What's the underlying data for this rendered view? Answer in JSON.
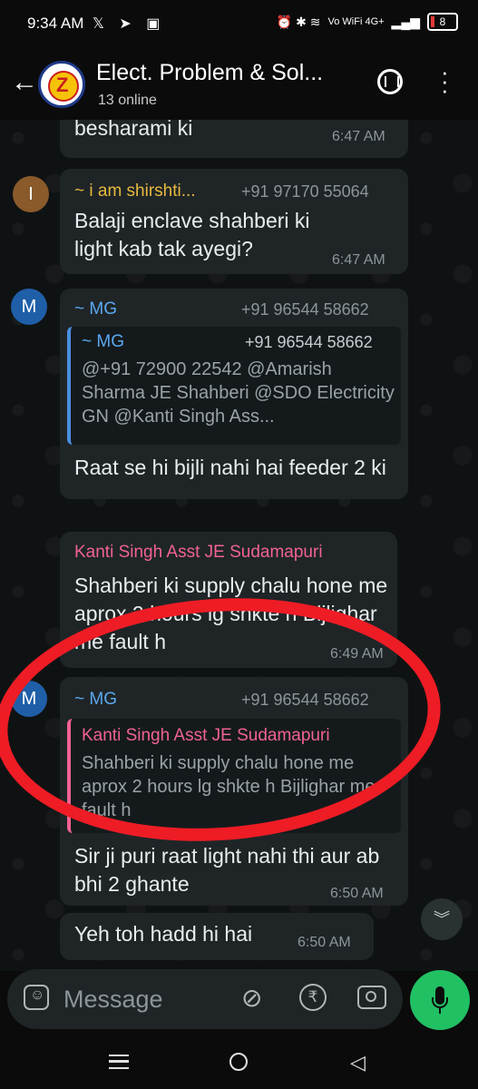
{
  "status_bar": {
    "time": "9:34 AM",
    "left_icons": "𝕏 ➤ ▣",
    "right_icons": "⏰ ✱ ≋",
    "network": "Vo WiFi 4G+",
    "battery": "8"
  },
  "header": {
    "title": "Elect. Problem & Sol...",
    "subtitle": "13 online"
  },
  "messages": [
    {
      "text": "besharami ki",
      "time": "6:47 AM"
    },
    {
      "avatar": "I",
      "sender": "~ i am shirshti...",
      "phone": "+91 97170 55064",
      "text": "Balaji enclave shahberi ki light kab tak ayegi?",
      "time": "6:47 AM"
    },
    {
      "avatar": "M",
      "sender": "~ MG",
      "phone": "+91 96544 58662",
      "quote": {
        "sender": "~ MG",
        "phone": "+91 96544 58662",
        "text": "@+91 72900 22542 @Amarish Sharma JE Shahberi @SDO Electricity GN @Kanti Singh Ass..."
      },
      "text": "Raat se hi bijli nahi hai feeder 2 ki",
      "time": "6:47 AM"
    },
    {
      "sender": "Kanti Singh Asst JE Sudamapuri",
      "text": "Shahberi ki supply chalu hone me aprox 2 hours lg shkte h Bijlighar me fault h",
      "time": "6:49 AM"
    },
    {
      "avatar": "M",
      "sender": "~ MG",
      "phone": "+91 96544 58662",
      "quote": {
        "sender": "Kanti Singh Asst JE Sudamapuri",
        "text": "Shahberi ki supply chalu hone me aprox 2 hours lg shkte h Bijlighar me fault h"
      },
      "text": "Sir ji puri raat light nahi thi aur ab bhi 2 ghante",
      "time": "6:50 AM"
    },
    {
      "text": "Yeh toh hadd hi hai",
      "time": "6:50 AM"
    }
  ],
  "input": {
    "placeholder": "Message"
  },
  "colors": {
    "accent_green": "#21c063",
    "sender_yellow": "#e6b93e",
    "sender_blue": "#5aa8f0",
    "sender_pink": "#f06292",
    "annotation_red": "#ee1c25"
  }
}
